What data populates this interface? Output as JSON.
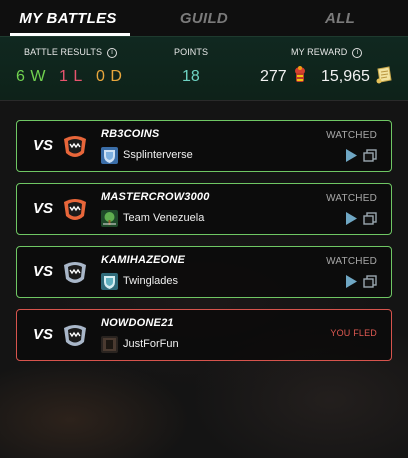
{
  "tabs": [
    {
      "label": "MY BATTLES",
      "active": true
    },
    {
      "label": "GUILD",
      "active": false
    },
    {
      "label": "ALL",
      "active": false
    }
  ],
  "stats": {
    "battle_results_label": "BATTLE RESULTS",
    "wins": "6 W",
    "losses": "1 L",
    "draws": "0 D",
    "points_label": "POINTS",
    "points_value": "18",
    "reward_label": "MY REWARD",
    "reward_chests": "277",
    "reward_dec": "15,965"
  },
  "colors": {
    "win": "#70d14f",
    "loss": "#e8546e",
    "draw": "#e8a63c",
    "points": "#6ed3c2",
    "watched_border": "#6fc764",
    "fled_border": "#d7544d",
    "fled_text": "#e05a52"
  },
  "icons": {
    "info": "info-circle-icon",
    "reward_chest": "red-potion-chest-icon",
    "reward_dec": "dec-scroll-icon",
    "play": "play-icon",
    "copy": "copy-icon"
  },
  "battles": [
    {
      "vs": "VS",
      "opponent": "RB3COINS",
      "guild": "Ssplinterverse",
      "status": "WATCHED",
      "badge_color": "#e8663a",
      "guild_icon": "shield-guild-icon",
      "actions": true
    },
    {
      "vs": "VS",
      "opponent": "MASTERCROW3000",
      "guild": "Team Venezuela",
      "status": "WATCHED",
      "badge_color": "#e8663a",
      "guild_icon": "tree-guild-icon",
      "actions": true
    },
    {
      "vs": "VS",
      "opponent": "KAMIHAZEONE",
      "guild": "Twinglades",
      "status": "WATCHED",
      "badge_color": "#a9b7c9",
      "guild_icon": "shield-guild-icon",
      "actions": true
    },
    {
      "vs": "VS",
      "opponent": "NOWDONE21",
      "guild": "JustForFun",
      "status": "YOU FLED",
      "badge_color": "#a9b7c9",
      "guild_icon": "dark-guild-icon",
      "actions": false
    }
  ]
}
